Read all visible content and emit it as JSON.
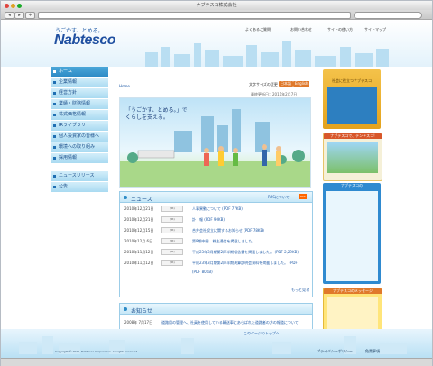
{
  "window": {
    "title": "ナブテスコ株式会社"
  },
  "header": {
    "tagline": "うごかす、とめる。",
    "logo": "Nabtesco",
    "topnav": [
      "よくあるご質問",
      "お問い合わせ",
      "サイトの使い方",
      "サイトマップ"
    ]
  },
  "leftnav": {
    "items": [
      "ホーム",
      "企業情報",
      "経営方針",
      "業績・財務情報",
      "株式価格情報",
      "IRライブラリー",
      "個人投資家の皆様へ",
      "環境への取り組み",
      "採用情報"
    ],
    "items2": [
      "ニュースリリース",
      "公告"
    ]
  },
  "main": {
    "breadcrumb": "Home",
    "font_size_label": "文字サイズの変更",
    "lang_badges": [
      "日本語",
      "English"
    ],
    "updated": "最終更新日：2011年2月7日",
    "hero_text_1": "「うごかす、とめる。」で",
    "hero_text_2": "くらしを支える。",
    "news": {
      "title": "ニュース",
      "rss": "RSSについて",
      "rows": [
        {
          "date": "2010年12月21日",
          "tag": "(IR)",
          "text": "人事異動について (PDF 77KB)"
        },
        {
          "date": "2010年12月21日",
          "tag": "(IR)",
          "text": "訃　報 (PDF 90KB)"
        },
        {
          "date": "2010年12月15日",
          "tag": "(IR)",
          "text": "合弁会社設立に関するお知らせ (PDF 78KB)"
        },
        {
          "date": "2010年12月 6日",
          "tag": "(IR)",
          "text": "第8期中間　株主通信を掲載しました。"
        },
        {
          "date": "2010年11月12日",
          "tag": "(IR)",
          "text": "平成23年3月期第2四半期報告書を掲載しました。 (PDF 2,29KB)"
        },
        {
          "date": "2010年11月12日",
          "tag": "(IR)",
          "text": "平成23年3月期第2四半期決算説明会資料を掲載しました。 (PDF"
        },
        {
          "date": "",
          "tag": "",
          "text": "(PDF 80KB)"
        }
      ],
      "more": "もっと見る"
    },
    "notice": {
      "title": "お知らせ",
      "rows": [
        {
          "date": "2008年 7月17日",
          "text": "道路用の管理へ、社員を使用している輸送車にあらばれた道路者の方の報道について"
        }
      ],
      "more": "もっと見る"
    },
    "to_top": "このページのトップへ"
  },
  "right": {
    "banner1": "社会に役立つナブテスコ",
    "banner2": "ナブテスコで、テンテスコ!",
    "banner3": "ナブテスコの",
    "banner4": "ナブテスコのメッセージ"
  },
  "footer": {
    "copyright": "Copyright © 2011, Nabtesco Corporation. All rights reserved.",
    "links": [
      "プライバシーポリシー",
      "免責事項"
    ]
  }
}
